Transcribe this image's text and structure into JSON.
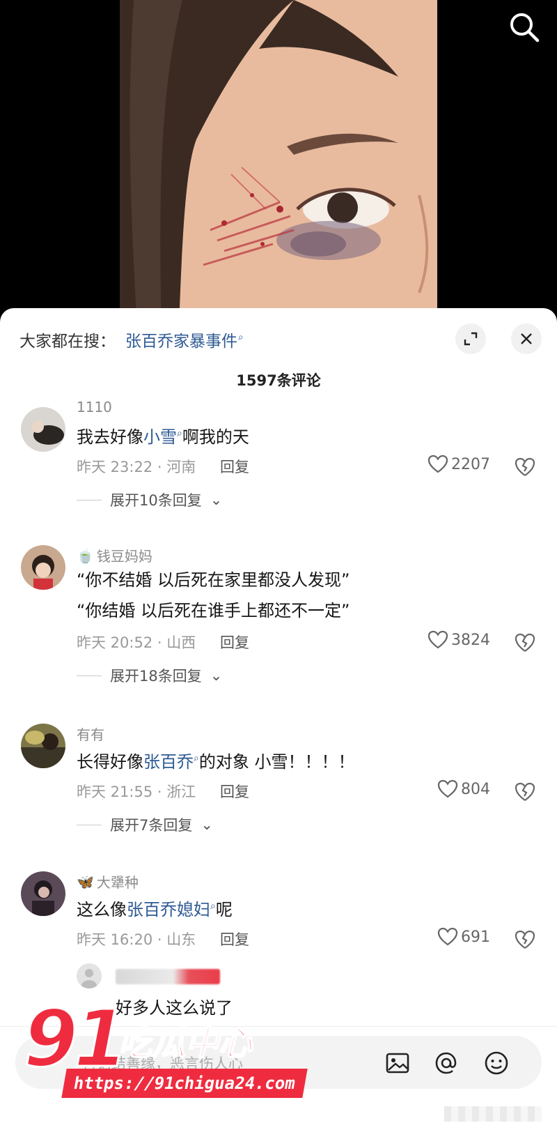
{
  "sheet": {
    "trending_label": "大家都在搜：",
    "trending_term": "张百乔家暴事件",
    "comment_count": "1597条评论"
  },
  "comments": [
    {
      "user": "1110",
      "text_parts": [
        "我去好像",
        "小雪",
        "啊我的天"
      ],
      "meta": "昨天 23:22 · 河南",
      "reply": "回复",
      "likes": "2207",
      "expand": "展开10条回复"
    },
    {
      "user_emoji": "🍵",
      "user": "钱豆妈妈",
      "line1": "“你不结婚 以后死在家里都没人发现”",
      "line2": "“你结婚 以后死在谁手上都还不一定”",
      "meta": "昨天 20:52 · 山西",
      "reply": "回复",
      "likes": "3824",
      "expand": "展开18条回复"
    },
    {
      "user": "有有",
      "text_parts": [
        "长得好像",
        "张百乔",
        "的对象  小雪！！！！"
      ],
      "meta": "昨天 21:55 · 浙江",
      "reply": "回复",
      "likes": "804",
      "expand": "展开7条回复"
    },
    {
      "user_emoji": "🦋",
      "user": "大犟种",
      "text_parts": [
        "这么像",
        "张百乔媳妇",
        "呢"
      ],
      "meta": "昨天 16:20 · 山东",
      "reply": "回复",
      "likes": "691"
    }
  ],
  "sub_reply": {
    "text": "好多人这么说了"
  },
  "input": {
    "placeholder": "善语结善缘，恶言伤人心"
  },
  "watermark": {
    "big": "91",
    "cn": "吃瓜中心",
    "url": "https://91chigua24.com"
  },
  "icons": [
    "search-icon",
    "expand-icon",
    "close-icon",
    "heart-icon",
    "broken-heart-icon",
    "image-icon",
    "at-icon",
    "emoji-icon"
  ]
}
